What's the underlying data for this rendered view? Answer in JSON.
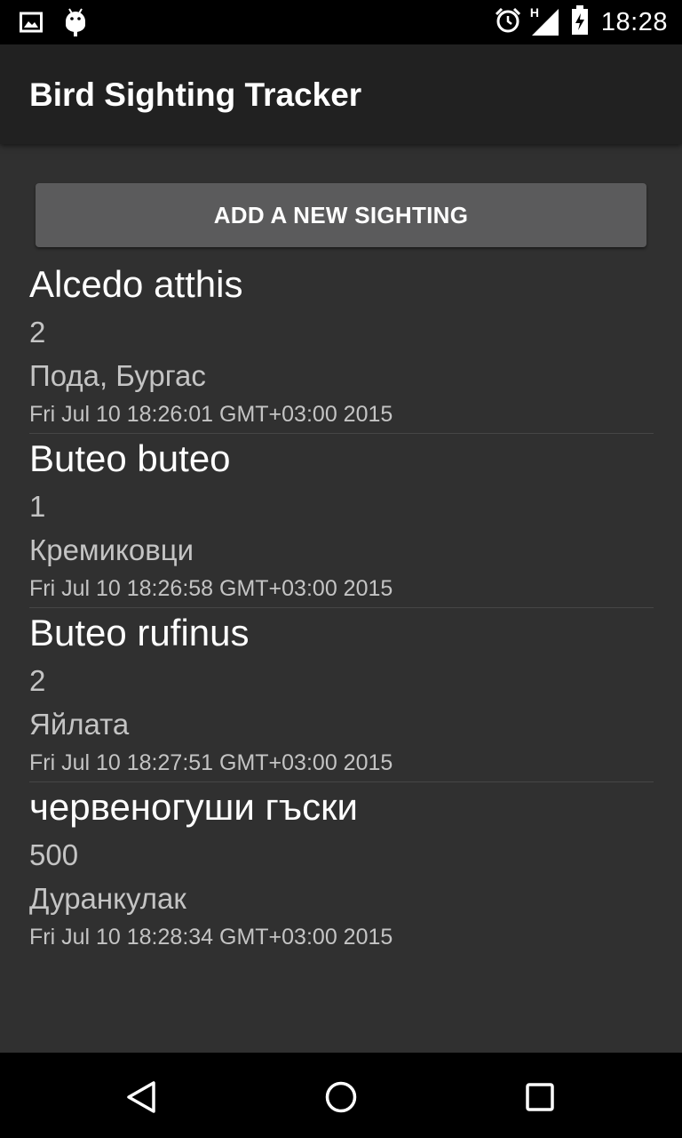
{
  "status_bar": {
    "time": "18:28",
    "network_label": "H",
    "icons": [
      "image-notification-icon",
      "android-notification-icon",
      "alarm-icon",
      "signal-icon",
      "battery-icon"
    ]
  },
  "app": {
    "title": "Bird Sighting Tracker"
  },
  "add_button": {
    "label": "ADD A NEW SIGHTING"
  },
  "sightings": [
    {
      "species": "Alcedo atthis",
      "count": "2",
      "location": "Пода, Бургас",
      "date": "Fri Jul 10 18:26:01 GMT+03:00 2015"
    },
    {
      "species": "Buteo buteo",
      "count": "1",
      "location": "Кремиковци",
      "date": "Fri Jul 10 18:26:58 GMT+03:00 2015"
    },
    {
      "species": "Buteo rufinus",
      "count": "2",
      "location": "Яйлата",
      "date": "Fri Jul 10 18:27:51 GMT+03:00 2015"
    },
    {
      "species": "червеногуши гъски",
      "count": "500",
      "location": "Дуранкулак",
      "date": "Fri Jul 10 18:28:34 GMT+03:00 2015"
    }
  ],
  "nav_bar": {
    "icons": [
      "back-icon",
      "home-icon",
      "recents-icon"
    ]
  },
  "colors": {
    "background": "#303030",
    "action_bar": "#212121",
    "button": "#5b5b5c",
    "secondary_text": "#c4c4c4"
  }
}
